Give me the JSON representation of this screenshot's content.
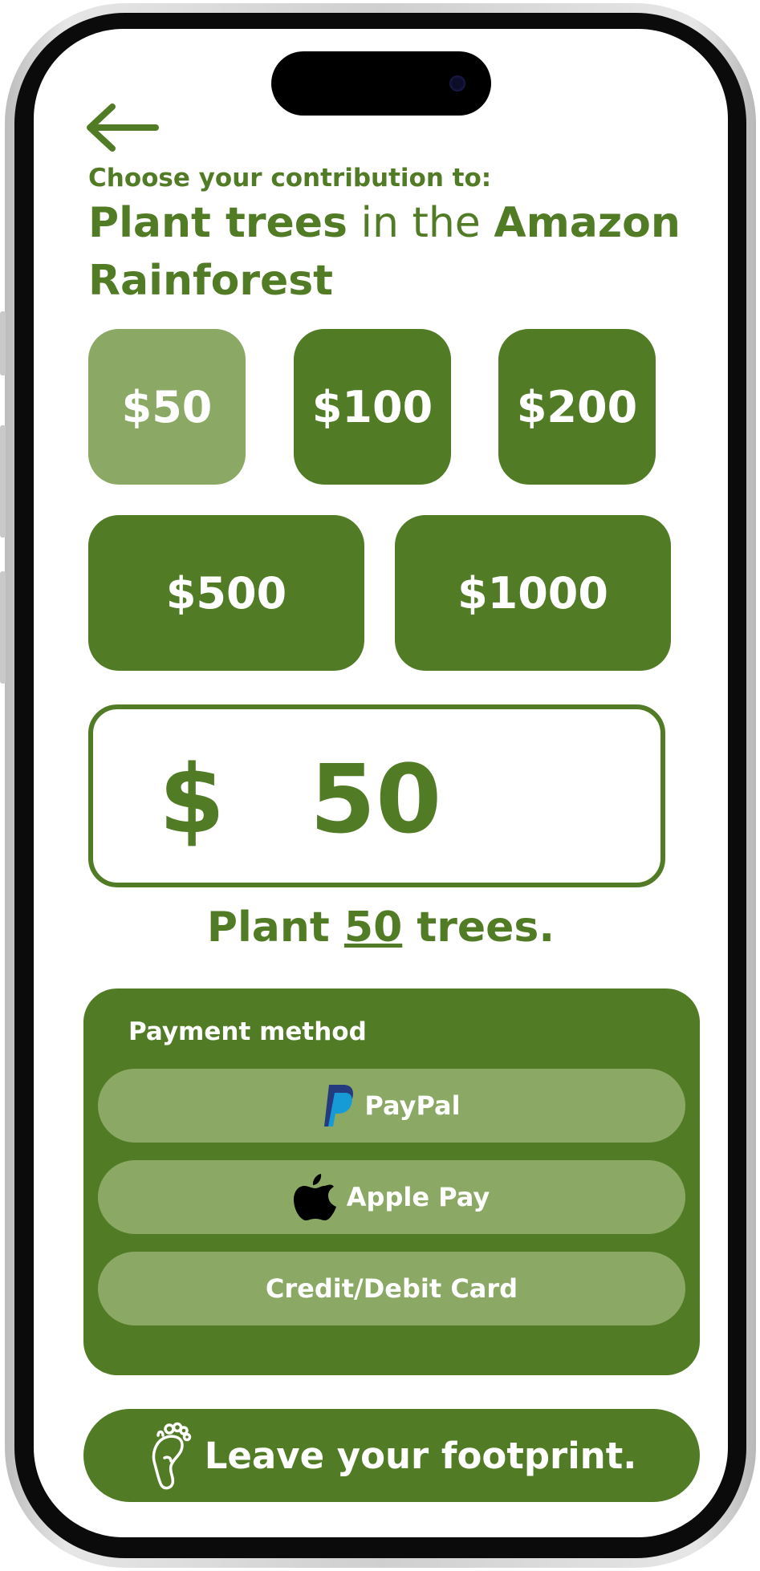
{
  "header": {
    "subtitle": "Choose your contribution to:",
    "title_part1": "Plant trees",
    "title_part2": " in the ",
    "title_part3": "Amazon Rainforest"
  },
  "amount_options": [
    {
      "label": "$50",
      "selected": true
    },
    {
      "label": "$100",
      "selected": false
    },
    {
      "label": "$200",
      "selected": false
    },
    {
      "label": "$500",
      "selected": false
    },
    {
      "label": "$1000",
      "selected": false
    }
  ],
  "custom_amount": {
    "currency_symbol": "$",
    "value": "50"
  },
  "tree_summary": {
    "prefix": "Plant ",
    "count": "50",
    "suffix": " trees."
  },
  "payment": {
    "title": "Payment method",
    "options": [
      {
        "label": "PayPal",
        "icon": "paypal-icon"
      },
      {
        "label": "Apple Pay",
        "icon": "apple-icon"
      },
      {
        "label": "Credit/Debit Card",
        "icon": ""
      }
    ]
  },
  "cta": {
    "label": "Leave your footprint.",
    "icon": "footprint-icon"
  },
  "colors": {
    "primary": "#527b26",
    "primary_light": "#8ba965",
    "background": "#ffffff",
    "text_on_primary": "#ffffff"
  }
}
